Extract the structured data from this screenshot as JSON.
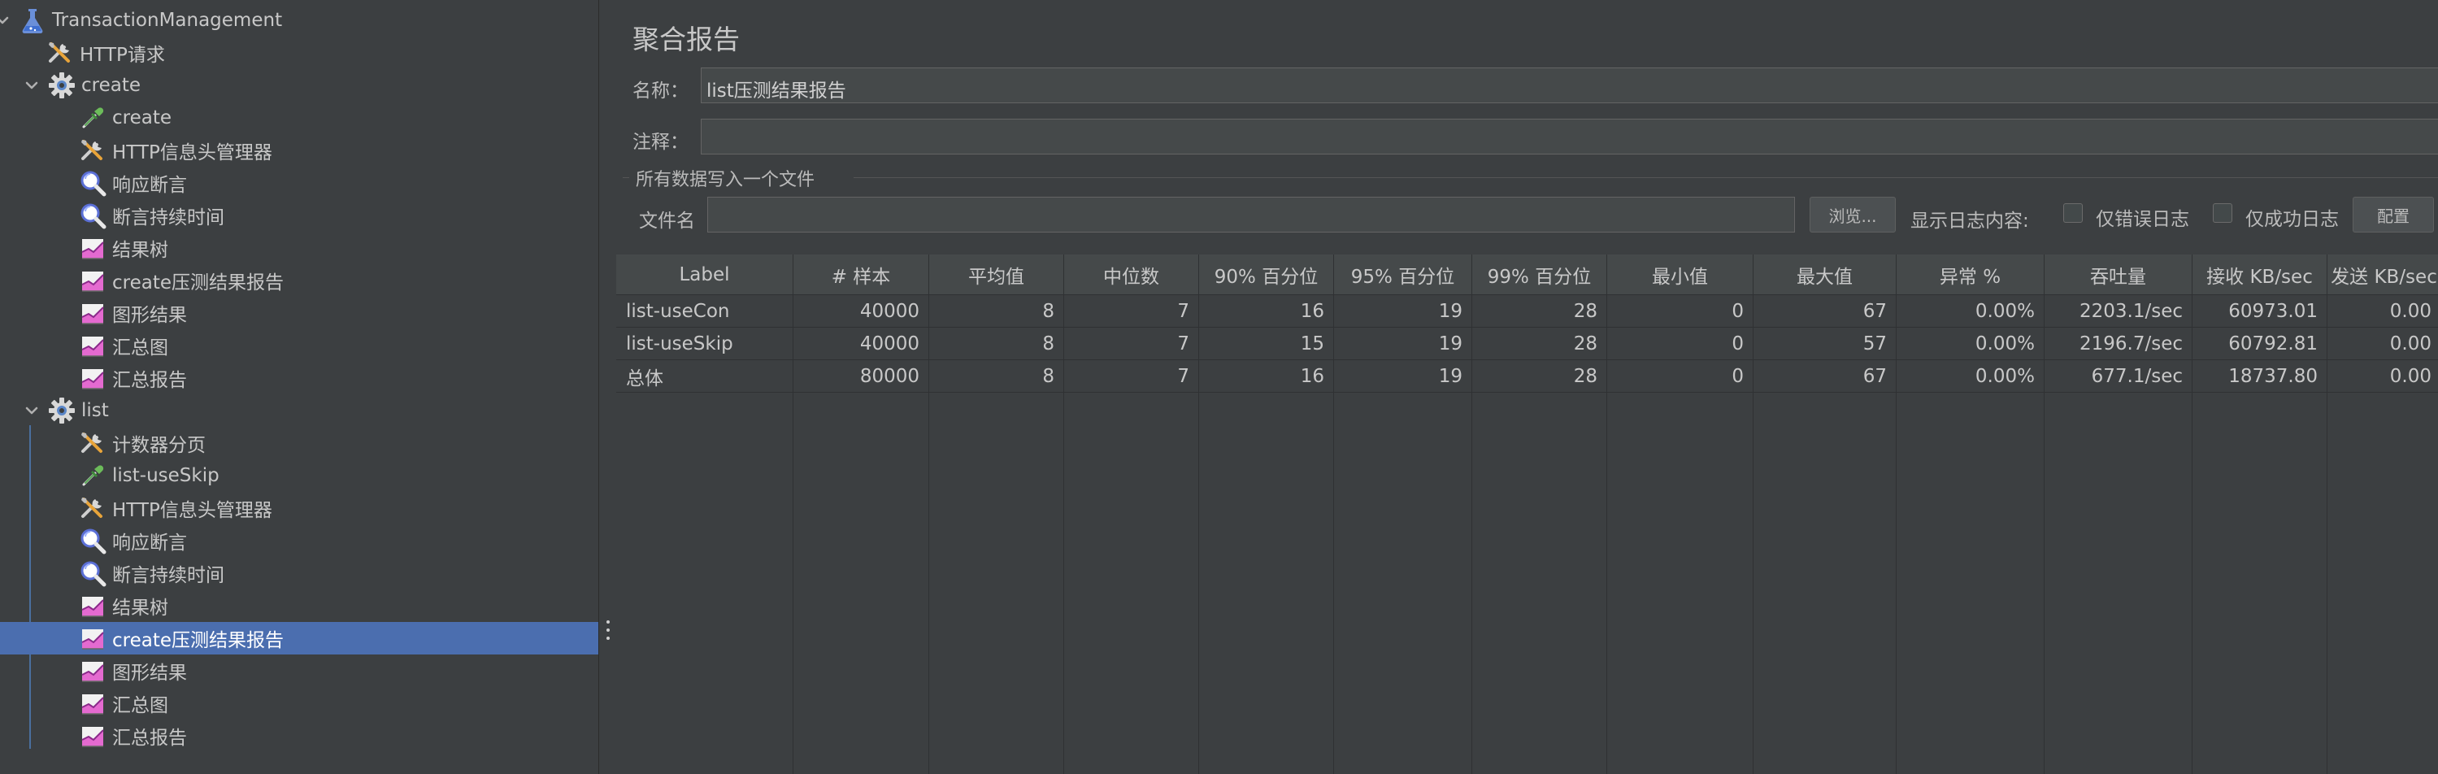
{
  "tree": {
    "items": [
      {
        "label": "TransactionManagement",
        "icon": "flask-icon",
        "expanded": true
      },
      {
        "label": "HTTP请求",
        "icon": "tools-icon"
      },
      {
        "label": "create",
        "icon": "gear-icon",
        "expanded": true
      },
      {
        "label": "create",
        "icon": "pipette-icon"
      },
      {
        "label": "HTTP信息头管理器",
        "icon": "tools-icon"
      },
      {
        "label": "响应断言",
        "icon": "magnifier-icon"
      },
      {
        "label": "断言持续时间",
        "icon": "magnifier-icon"
      },
      {
        "label": "结果树",
        "icon": "graph-icon"
      },
      {
        "label": "create压测结果报告",
        "icon": "graph-icon"
      },
      {
        "label": "图形结果",
        "icon": "graph-icon"
      },
      {
        "label": "汇总图",
        "icon": "graph-icon"
      },
      {
        "label": "汇总报告",
        "icon": "graph-icon"
      },
      {
        "label": "list",
        "icon": "gear-icon",
        "expanded": true
      },
      {
        "label": "计数器分页",
        "icon": "tools-icon"
      },
      {
        "label": "list-useSkip",
        "icon": "pipette-icon"
      },
      {
        "label": "HTTP信息头管理器",
        "icon": "tools-icon"
      },
      {
        "label": "响应断言",
        "icon": "magnifier-icon"
      },
      {
        "label": "断言持续时间",
        "icon": "magnifier-icon"
      },
      {
        "label": "结果树",
        "icon": "graph-icon"
      },
      {
        "label": "create压测结果报告",
        "icon": "graph-icon",
        "selected": true
      },
      {
        "label": "图形结果",
        "icon": "graph-icon"
      },
      {
        "label": "汇总图",
        "icon": "graph-icon"
      },
      {
        "label": "汇总报告",
        "icon": "graph-icon"
      }
    ]
  },
  "panel": {
    "title": "聚合报告",
    "name_label": "名称：",
    "name_value": "list压测结果报告",
    "comment_label": "注释：",
    "comment_value": "",
    "group_title": "所有数据写入一个文件",
    "file_label": "文件名",
    "file_value": "",
    "browse_label": "浏览...",
    "log_label": "显示日志内容:",
    "errors_only_label": "仅错误日志",
    "success_only_label": "仅成功日志",
    "config_label": "配置"
  },
  "table": {
    "headers": [
      "Label",
      "# 样本",
      "平均值",
      "中位数",
      "90% 百分位",
      "95% 百分位",
      "99% 百分位",
      "最小值",
      "最大值",
      "异常 %",
      "吞吐量",
      "接收 KB/sec",
      "发送 KB/sec"
    ],
    "rows": [
      [
        "list-useCon",
        "40000",
        "8",
        "7",
        "16",
        "19",
        "28",
        "0",
        "67",
        "0.00%",
        "2203.1/sec",
        "60973.01",
        "0.00"
      ],
      [
        "list-useSkip",
        "40000",
        "8",
        "7",
        "15",
        "19",
        "28",
        "0",
        "57",
        "0.00%",
        "2196.7/sec",
        "60792.81",
        "0.00"
      ],
      [
        "总体",
        "80000",
        "8",
        "7",
        "16",
        "19",
        "28",
        "0",
        "67",
        "0.00%",
        "677.1/sec",
        "18737.80",
        "0.00"
      ]
    ]
  },
  "colors": {
    "background": "#3c3f41",
    "selection": "#4b6eaf",
    "table_header": "#45494a",
    "grid": "#2f3133"
  }
}
